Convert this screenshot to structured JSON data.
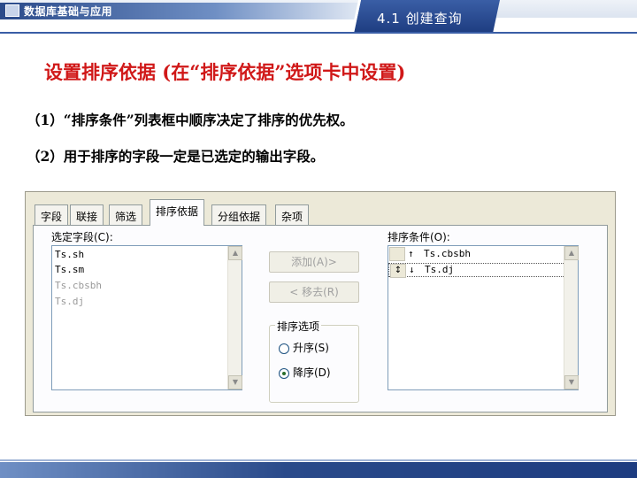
{
  "header": {
    "course_title": "数据库基础与应用",
    "section": "4.1 创建查询"
  },
  "slide": {
    "title": "设置排序依据 (在“排序依据”选项卡中设置)",
    "points": [
      "（1）“排序条件”列表框中顺序决定了排序的优先权。",
      "（2）用于排序的字段一定是已选定的输出字段。"
    ]
  },
  "dialog": {
    "tabs": [
      "字段",
      "联接",
      "筛选",
      "排序依据",
      "分组依据",
      "杂项"
    ],
    "active_tab": "排序依据",
    "selected_fields_label": "选定字段(C):",
    "selected_fields": [
      {
        "text": "Ts.sh",
        "dim": false
      },
      {
        "text": "Ts.sm",
        "dim": false
      },
      {
        "text": "Ts.cbsbh",
        "dim": true
      },
      {
        "text": "Ts.dj",
        "dim": true
      }
    ],
    "add_button": "添加(A)>",
    "remove_button": "< 移去(R)",
    "sort_options_label": "排序选项",
    "ascending_label": "升序(S)",
    "descending_label": "降序(D)",
    "selected_option": "descending",
    "sort_conditions_label": "排序条件(O):",
    "sort_conditions": [
      {
        "arrow": "↑",
        "text": "Ts.cbsbh"
      },
      {
        "arrow": "↓",
        "text": "Ts.dj"
      }
    ]
  }
}
